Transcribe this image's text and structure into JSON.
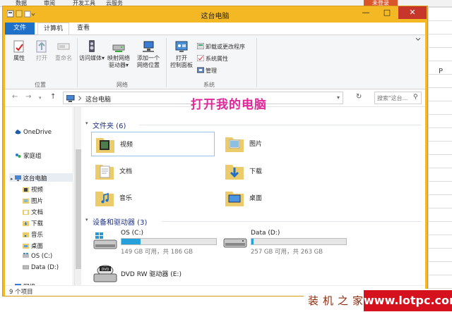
{
  "background": {
    "menu": [
      "数据",
      "审阅",
      "开发工具",
      "云服务"
    ],
    "red_button": "未登录",
    "column_p": "P"
  },
  "window": {
    "title": "这台电脑",
    "min_glyph": "—",
    "max_glyph": "□",
    "close_glyph": "✕"
  },
  "tabs": [
    "文件",
    "计算机",
    "查看"
  ],
  "ribbon": {
    "location": {
      "group": "位置",
      "buttons": [
        "属性",
        "打开",
        "重命名"
      ]
    },
    "network": {
      "group": "网络",
      "media_line1": "访问媒体",
      "map_line1": "映射网络",
      "map_line2": "驱动器",
      "addloc_line1": "添加一个",
      "addloc_line2": "网络位置"
    },
    "system": {
      "group": "系统",
      "panel_line1": "打开",
      "panel_line2": "控制面板",
      "uninstall": "卸载或更改程序",
      "sysprops": "系统属性",
      "manage": "管理"
    }
  },
  "address": {
    "path": "这台电脑",
    "search_placeholder": "搜索\"这台..."
  },
  "annotation": "打开我的电脑",
  "nav_pane": {
    "onedrive": "OneDrive",
    "homegroup": "家庭组",
    "thispc": "这台电脑",
    "items": [
      "视频",
      "图片",
      "文档",
      "下载",
      "音乐",
      "桌面",
      "OS (C:)",
      "Data (D:)"
    ],
    "network": "网络"
  },
  "folders": {
    "header": "文件夹 (6)",
    "items": [
      "视频",
      "图片",
      "文档",
      "下载",
      "音乐",
      "桌面"
    ]
  },
  "drives": {
    "header": "设备和驱动器 (3)",
    "list": [
      {
        "name": "OS (C:)",
        "status": "149 GB 可用，共 186 GB",
        "used_fraction": 0.2
      },
      {
        "name": "Data (D:)",
        "status": "257 GB 可用，共 263 GB",
        "used_fraction": 0.02
      },
      {
        "name": "DVD RW 驱动器 (E:)"
      }
    ],
    "dvd_badge": "DVD"
  },
  "status": "9 个项目",
  "watermark": {
    "left": "装机之家",
    "right": "www.lotpc.com"
  },
  "colors": {
    "window_frame": "#f3b823",
    "file_tab": "#1e70c8",
    "close": "#c7362b",
    "annotation": "#e0289a",
    "drive_fill": "#26a0da",
    "watermark_red": "#d4111d"
  }
}
